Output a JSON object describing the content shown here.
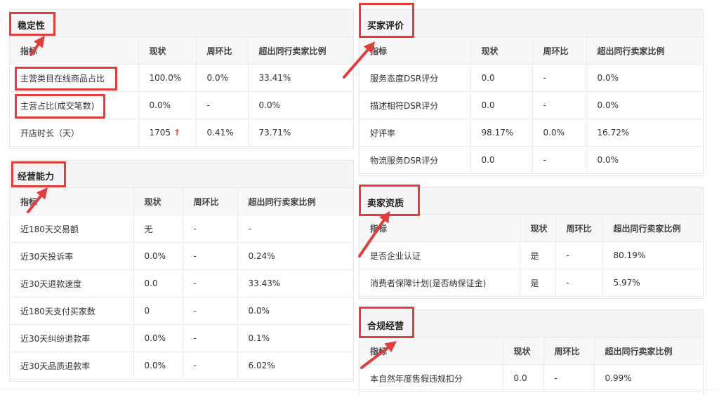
{
  "header_labels": {
    "indicator": "指标",
    "current": "现状",
    "wow": "周环比",
    "exceed": "超出同行卖家比例"
  },
  "stability": {
    "title": "稳定性",
    "rows": [
      [
        "主营类目在线商品占比",
        "100.0%",
        "0.0%",
        "33.41%"
      ],
      [
        "主营占比(成交笔数)",
        "0.0%",
        "-",
        "0.0%"
      ],
      [
        "开店时长（天）",
        "1705",
        "0.41%",
        "73.71%"
      ]
    ],
    "trend_arrow": "↑"
  },
  "operation": {
    "title": "经营能力",
    "rows": [
      [
        "近180天交易额",
        "无",
        "-",
        "-"
      ],
      [
        "近30天投诉率",
        "0.0%",
        "-",
        "0.24%"
      ],
      [
        "近30天退款速度",
        "0.0",
        "-",
        "33.43%"
      ],
      [
        "近180天支付买家数",
        "0",
        "-",
        "0.0%"
      ],
      [
        "近30天纠纷退款率",
        "0.0%",
        "-",
        "0.1%"
      ],
      [
        "近30天品质退款率",
        "0.0%",
        "-",
        "6.02%"
      ]
    ]
  },
  "buyer_review": {
    "title": "买家评价",
    "rows": [
      [
        "服务态度DSR评分",
        "0.0",
        "-",
        "0.0%"
      ],
      [
        "描述相符DSR评分",
        "0.0",
        "-",
        "0.0%"
      ],
      [
        "好评率",
        "98.17%",
        "0.0%",
        "16.72%"
      ],
      [
        "物流服务DSR评分",
        "0.0",
        "-",
        "0.0%"
      ]
    ]
  },
  "seller_qualification": {
    "title": "卖家资质",
    "rows": [
      [
        "是否企业认证",
        "是",
        "-",
        "80.19%"
      ],
      [
        "消费者保障计划(是否纳保证金)",
        "是",
        "-",
        "5.97%"
      ]
    ]
  },
  "compliance": {
    "title": "合规经营",
    "rows": [
      [
        "本自然年度售假违规扣分",
        "0.0",
        "-",
        "0.99%"
      ]
    ]
  },
  "colors": {
    "highlight": "#e03d3d",
    "trend_up": "#e4393c",
    "header_bg": "#f5f5f5"
  }
}
